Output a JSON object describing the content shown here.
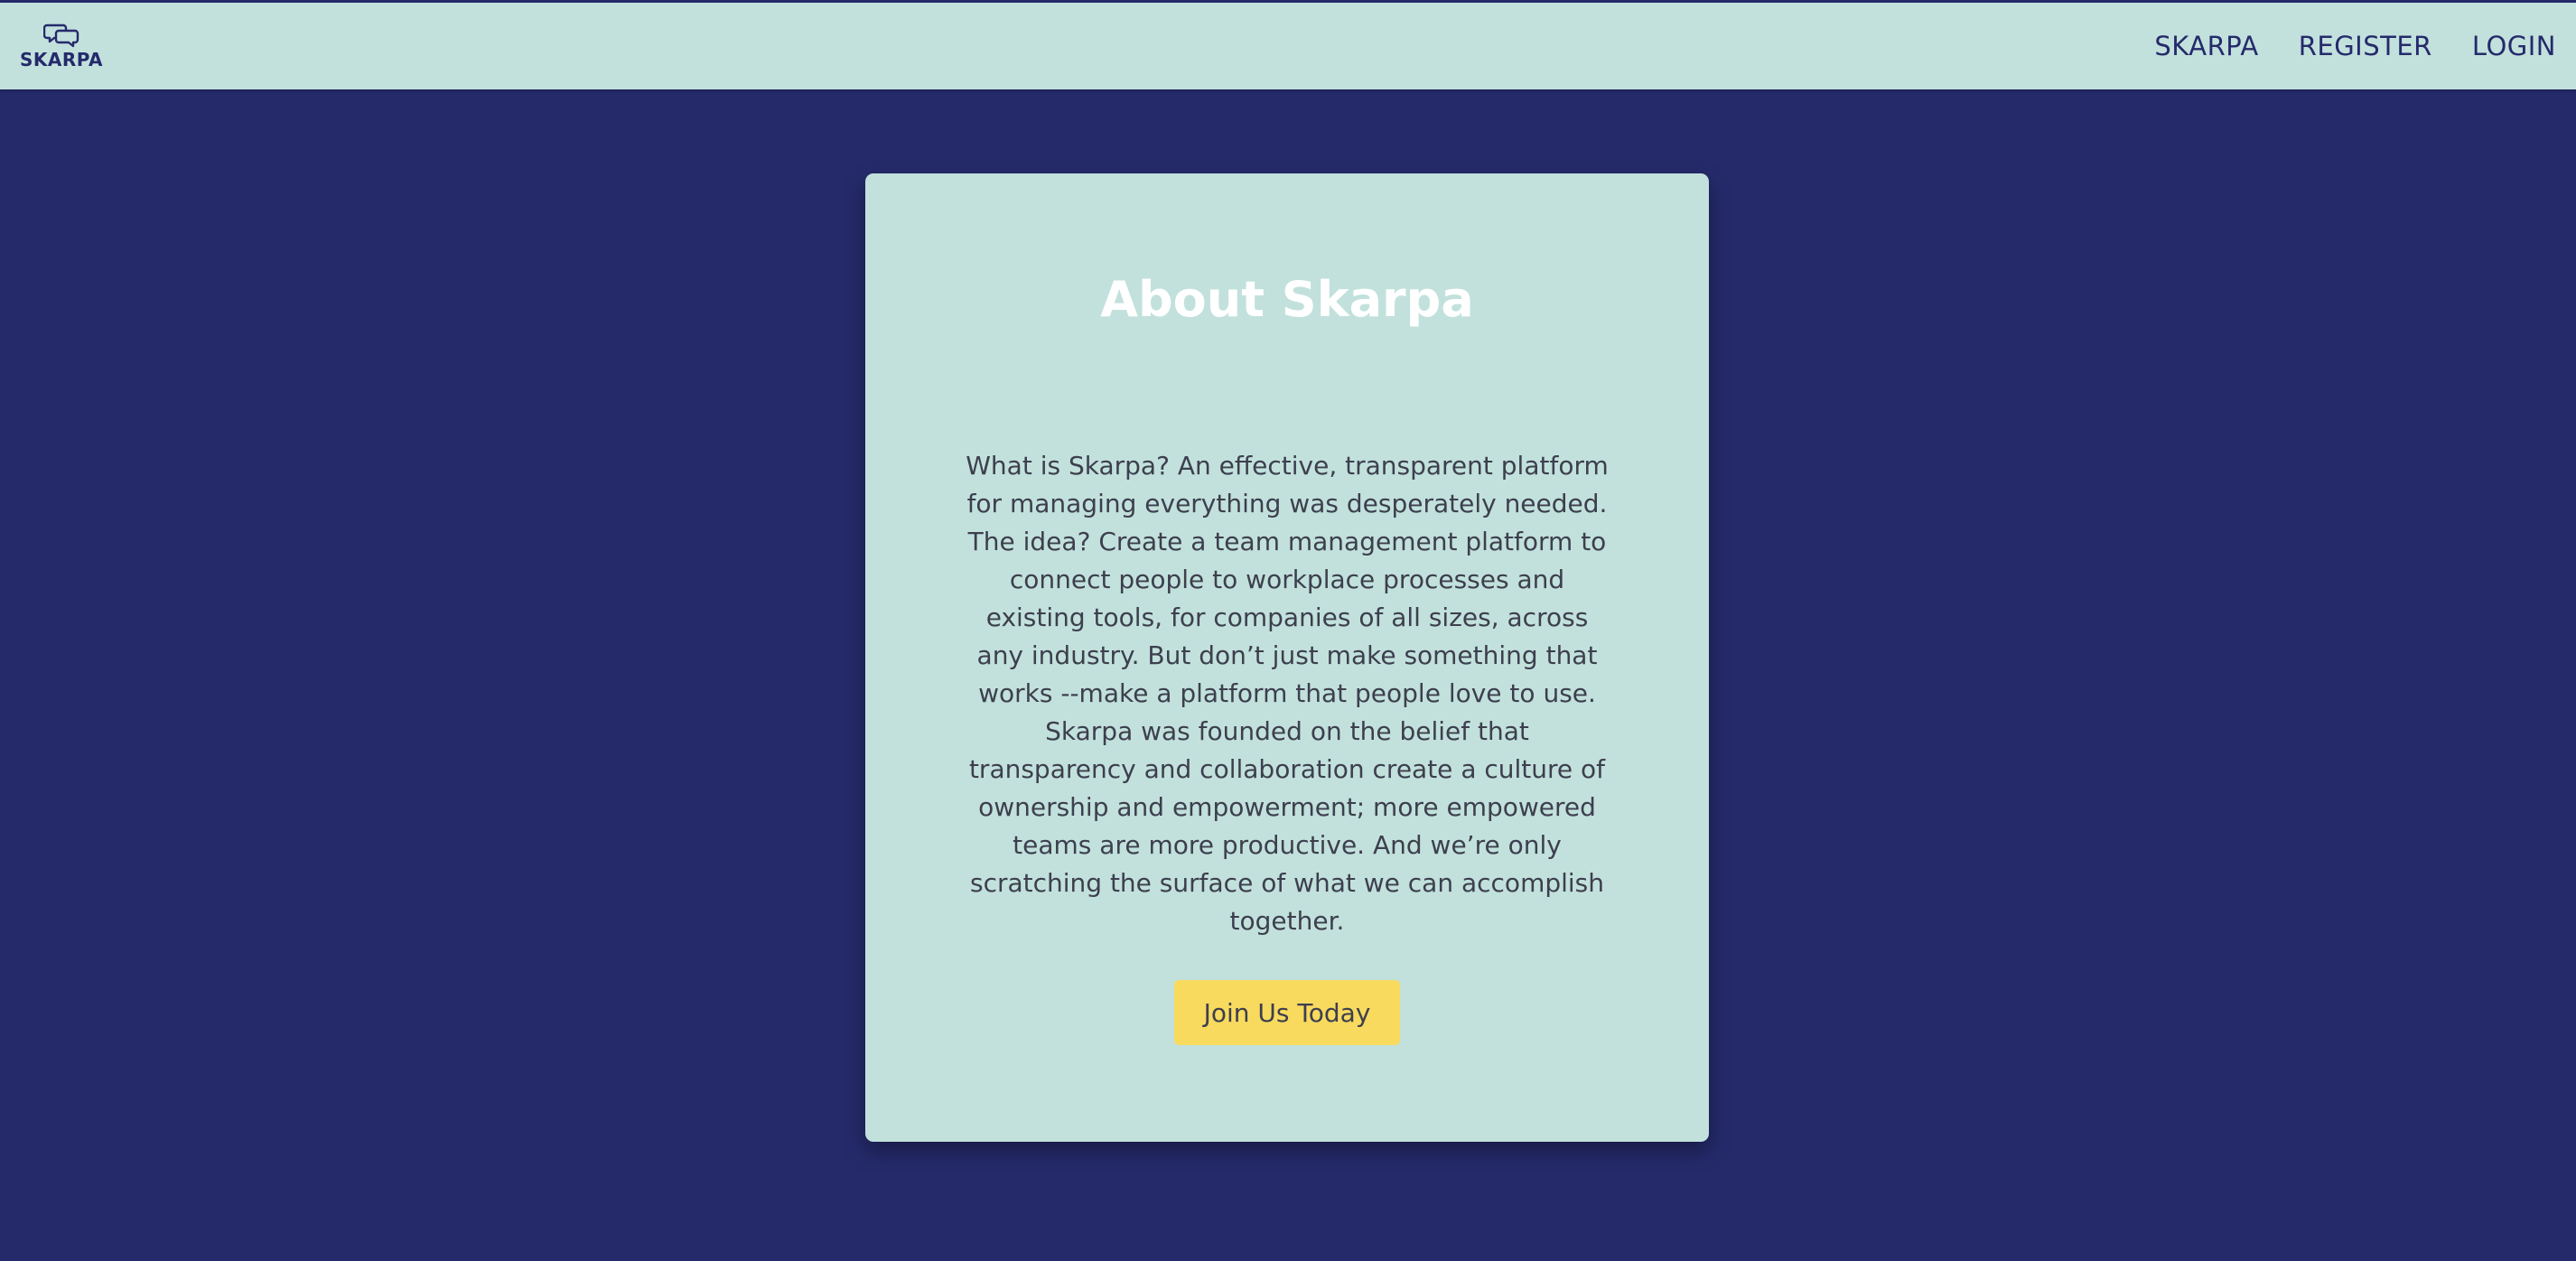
{
  "navbar": {
    "brand_text": "SKARPA",
    "links": [
      {
        "label": "SKARPA"
      },
      {
        "label": "REGISTER"
      },
      {
        "label": "LOGIN"
      }
    ]
  },
  "about": {
    "title": "About Skarpa",
    "paragraphs": [
      "What is Skarpa? An effective, transparent platform for managing everything was desperately needed.",
      "The idea? Create a team management platform to connect people to workplace processes and existing tools, for companies of all sizes, across any industry. But don’t just make something that works --make a platform that people love to use.",
      "Skarpa was founded on the belief that transparency and collaboration create a culture of ownership and empowerment; more empowered teams are more productive. And we’re only scratching the surface of what we can accomplish together."
    ],
    "cta_label": "Join Us Today"
  },
  "colors": {
    "page_background": "#252a6b",
    "navbar_background": "#c2e1dc",
    "card_background": "#c2e1dc",
    "brand_text": "#252a6b",
    "title_text": "#ffffff",
    "body_text": "#3d3f4e",
    "cta_background": "#f8da5e"
  },
  "icons": {
    "brand_logo": "chat-bubbles-icon"
  }
}
